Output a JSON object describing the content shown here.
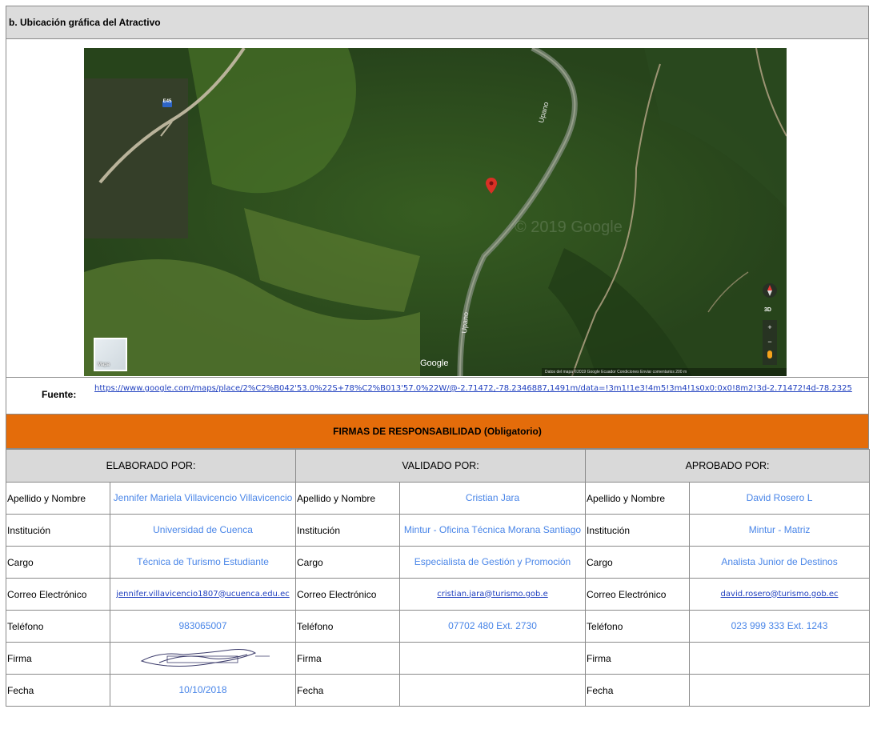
{
  "section": {
    "header": "b. Ubicación gráfica del Atractivo"
  },
  "map": {
    "road_label": "E45",
    "river_label_1": "Upano",
    "river_label_2": "Upano",
    "provider": "Google",
    "watermark": "© 2019 Google",
    "footer_text": "Datos del mapa ©2019 Google   Ecuador   Condiciones   Enviar comentarios   200 m",
    "thumbnail_label": "Mapa",
    "control_3d": "3D",
    "colors": {
      "forest": "#2f4a1c",
      "light_forest": "#5a7a2c",
      "marker": "#d93025"
    }
  },
  "fuente": {
    "label": "Fuente:",
    "link": "https://www.google.com/maps/place/2%C2%B042'53.0%22S+78%C2%B013'57.0%22W/@-2.71472,-78.2346887,1491m/data=!3m1!1e3!4m5!3m4!1s0x0:0x0!8m2!3d-2.71472!4d-78.2325"
  },
  "firmas": {
    "title": "FIRMAS DE RESPONSABILIDAD (Obligatorio)",
    "accent": "#e46c0a",
    "columns": [
      {
        "header": "ELABORADO POR:",
        "nombre_label": "Apellido y Nombre",
        "nombre": "Jennifer Mariela Villavicencio Villavicencio",
        "institucion_label": "Institución",
        "institucion": "Universidad de Cuenca",
        "cargo_label": "Cargo",
        "cargo": "Técnica de Turismo Estudiante",
        "correo_label": "Correo Electrónico",
        "correo": "jennifer.villavicencio1807@ucuenca.edu.ec",
        "telefono_label": "Teléfono",
        "telefono": "983065007",
        "firma_label": "Firma",
        "fecha_label": "Fecha",
        "fecha": "10/10/2018"
      },
      {
        "header": "VALIDADO  POR:",
        "nombre_label": "Apellido y Nombre",
        "nombre": "Cristian Jara",
        "institucion_label": "Institución",
        "institucion": "Mintur - Oficina Técnica Morana Santiago",
        "cargo_label": "Cargo",
        "cargo": "Especialista de Gestión y Promoción",
        "correo_label": "Correo Electrónico",
        "correo": "cristian.jara@turismo.gob.e",
        "telefono_label": "Teléfono",
        "telefono": "07702 480 Ext. 2730",
        "firma_label": "Firma",
        "fecha_label": "Fecha",
        "fecha": ""
      },
      {
        "header": "APROBADO POR:",
        "nombre_label": "Apellido y Nombre",
        "nombre": "David Rosero L",
        "institucion_label": "Institución",
        "institucion": "Mintur - Matriz",
        "cargo_label": "Cargo",
        "cargo": "Analista Junior de Destinos",
        "correo_label": "Correo Electrónico",
        "correo": "david.rosero@turismo.gob.ec",
        "telefono_label": "Teléfono",
        "telefono": "023 999 333 Ext. 1243",
        "firma_label": "Firma",
        "fecha_label": "Fecha",
        "fecha": ""
      }
    ]
  }
}
